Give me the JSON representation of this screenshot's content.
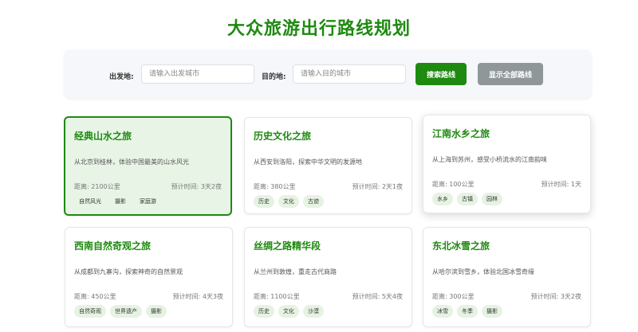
{
  "page": {
    "title": "大众旅游出行路线规划"
  },
  "search": {
    "origin_label": "出发地:",
    "origin_placeholder": "请输入出发城市",
    "origin_value": "",
    "destination_label": "目的地:",
    "destination_placeholder": "请输入目的城市",
    "destination_value": "",
    "search_button": "搜索路线",
    "show_all_button": "显示全部路线"
  },
  "colors": {
    "accent": "#1e8a10",
    "secondary_button": "#909799",
    "tag_bg": "#e6f3e3"
  },
  "routes": [
    {
      "name": "经典山水之旅",
      "description": "从北京到桂林，体验中国最美的山水风光",
      "distance": "距离: 2100公里",
      "duration": "预计时间: 3天2夜",
      "tags": [
        "自然风光",
        "摄影",
        "家庭游"
      ],
      "selected": true
    },
    {
      "name": "历史文化之旅",
      "description": "从西安到洛阳，探索中华文明的发源地",
      "distance": "距离: 380公里",
      "duration": "预计时间: 2天1夜",
      "tags": [
        "历史",
        "文化",
        "古迹"
      ]
    },
    {
      "name": "江南水乡之旅",
      "description": "从上海到苏州，感受小桥流水的江南韵味",
      "distance": "距离: 100公里",
      "duration": "预计时间: 1天",
      "tags": [
        "水乡",
        "古镇",
        "园林"
      ],
      "hovered": true
    },
    {
      "name": "西南自然奇观之旅",
      "description": "从成都到九寨沟，探索神奇的自然景观",
      "distance": "距离: 450公里",
      "duration": "预计时间: 4天3夜",
      "tags": [
        "自然奇观",
        "世界遗产",
        "摄影"
      ]
    },
    {
      "name": "丝绸之路精华段",
      "description": "从兰州到敦煌，重走古代商路",
      "distance": "距离: 1100公里",
      "duration": "预计时间: 5天4夜",
      "tags": [
        "历史",
        "文化",
        "沙漠"
      ]
    },
    {
      "name": "东北冰雪之旅",
      "description": "从哈尔滨到雪乡，体验北国冰雪奇缘",
      "distance": "距离: 300公里",
      "duration": "预计时间: 3天2夜",
      "tags": [
        "冰雪",
        "冬季",
        "摄影"
      ]
    }
  ]
}
